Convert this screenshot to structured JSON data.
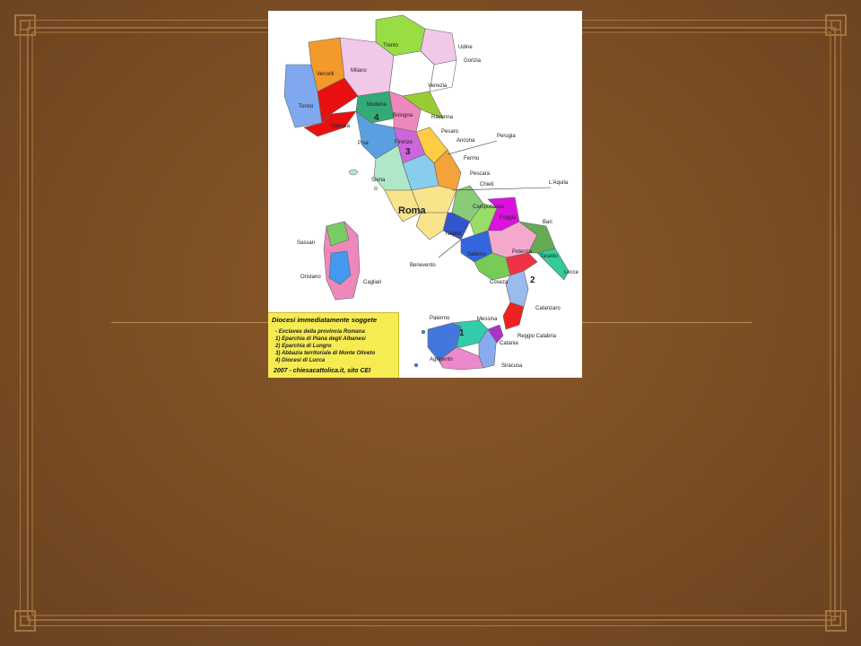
{
  "slide": {
    "background": "#7a4d24",
    "frame_color": "#9a6a3a",
    "rule_color": "#c9a36a"
  },
  "map": {
    "capital_label": "Roma",
    "city_labels": [
      "Trento",
      "Udine",
      "Gorizia",
      "Vercelli",
      "Milano",
      "Venezia",
      "Torino",
      "Modena",
      "Bologna",
      "Ravenna",
      "Genova",
      "Pisa",
      "Firenze",
      "Pesaro",
      "Ancona",
      "Perugia",
      "Fermo",
      "Siena",
      "Pescara",
      "Chieti",
      "L'Aquila",
      "Campobasso",
      "Foggia",
      "Bari",
      "Sassari",
      "Napoli",
      "Benevento",
      "Salerno",
      "Taranto",
      "Potenza",
      "Lecce",
      "Oristano",
      "Cagliari",
      "Coseza",
      "Catanzaro",
      "Palermo",
      "Messina",
      "Reggio Calabria",
      "Catania",
      "Agrigento",
      "Siracusa"
    ],
    "markers": [
      "1",
      "2",
      "3",
      "4"
    ],
    "legend": {
      "title": "Diocesi immediatamente soggete",
      "lines": [
        "- Exclaves della provincia Romana",
        "1) Eparchia di Piana degli Albanesi",
        "2) Eparchia di Lungro",
        "3) Abbazia territoriale di Monte Oliveto",
        "4) Diocesi di Lucca"
      ],
      "credit": "2007 - chiesacattolica.it, sito CEI"
    }
  }
}
